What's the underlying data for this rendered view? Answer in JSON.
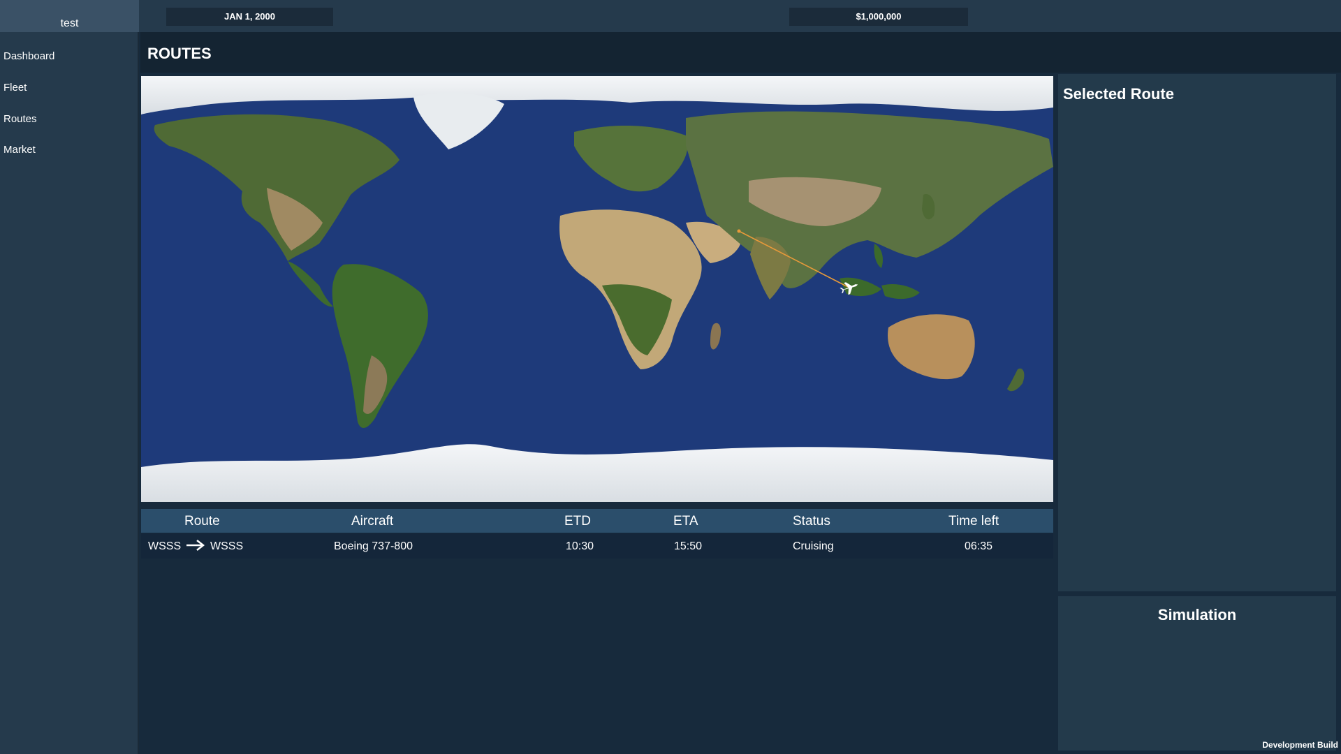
{
  "topbar": {
    "account_name": "test",
    "date": "JAN 1, 2000",
    "money": "$1,000,000"
  },
  "sidebar": {
    "items": [
      {
        "label": "Dashboard"
      },
      {
        "label": "Fleet"
      },
      {
        "label": "Routes"
      },
      {
        "label": "Market"
      }
    ]
  },
  "page": {
    "title": "ROUTES"
  },
  "table": {
    "headers": [
      "Route",
      "Aircraft",
      "ETD",
      "ETA",
      "Status",
      "Time left"
    ],
    "rows": [
      {
        "origin": "WSSS",
        "destination": "WSSS",
        "aircraft": "Boeing 737-800",
        "etd": "10:30",
        "eta": "15:50",
        "status": "Cruising",
        "time_left": "06:35"
      }
    ]
  },
  "panels": {
    "selected_route_title": "Selected Route",
    "simulation_title": "Simulation"
  },
  "footer": {
    "build_label": "Development Build"
  },
  "icons": {
    "route_arrow": "arrow-right-icon",
    "aircraft": "airplane-icon"
  },
  "colors": {
    "ocean": "#1e3a7a",
    "route_line": "#e89a3a",
    "table_header": "#2b4e6b",
    "panel": "#233a4b"
  }
}
